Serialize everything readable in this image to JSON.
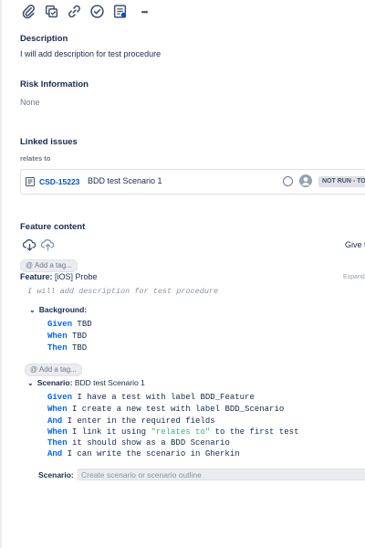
{
  "toolbar": {
    "icons": [
      "paperclip-icon",
      "subtask-icon",
      "link-icon",
      "check-circle-icon",
      "document-icon",
      "more-icon"
    ],
    "more_label": "•••"
  },
  "description": {
    "title": "Description",
    "text": "I will add description for test procedure"
  },
  "risk": {
    "title": "Risk Information",
    "text": "None"
  },
  "linked_issues": {
    "title": "Linked issues",
    "relation": "relates to",
    "issue": {
      "key": "CSD-15223",
      "summary": "BDD test Scenario 1",
      "status": "NOT RUN - TO"
    }
  },
  "feature_content": {
    "title": "Feature content",
    "give_link": "Give f",
    "expand_link": "Expand",
    "tag_placeholder": "@ Add a tag...",
    "feature_keyword": "Feature:",
    "feature_name": " [iOS] Probe",
    "feature_description": "I will add description for test procedure",
    "background": {
      "chevron": "⌄",
      "label": "Background:",
      "steps": [
        {
          "kw": "Given",
          "text": " TBD"
        },
        {
          "kw": "When",
          "text": " TBD"
        },
        {
          "kw": "Then",
          "text": " TBD"
        }
      ]
    },
    "scenario": {
      "chevron": "⌄",
      "label": "Scenario:",
      "name": " BDD test Scenario 1",
      "steps": [
        {
          "kw": "Given",
          "text": " I have a test with label BDD_Feature"
        },
        {
          "kw": "When",
          "text": " I create a new test with label BDD_Scenario"
        },
        {
          "kw": "And",
          "text": " I enter in the required fields"
        },
        {
          "kw": "When",
          "text": " I link it using ",
          "str": "\"relates to\"",
          "after": " to the first test"
        },
        {
          "kw": "Then",
          "text": " it should show as a BDD Scenario"
        },
        {
          "kw": "And",
          "text": " I can write the scenario in Gherkin"
        }
      ]
    },
    "new_scenario": {
      "label": "Scenario:",
      "placeholder": "Create scenario or scenario outline"
    }
  },
  "colors": {
    "keyword": "#0065ff",
    "string": "#36b37e",
    "link": "#0052cc",
    "text": "#172b4d"
  }
}
